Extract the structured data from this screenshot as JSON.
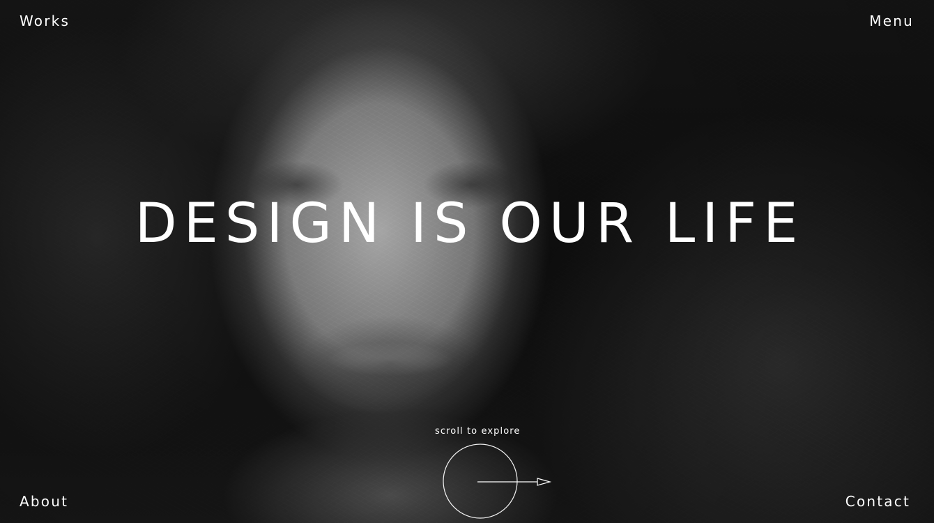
{
  "nav": {
    "works_label": "Works",
    "menu_label": "Menu",
    "about_label": "About",
    "contact_label": "Contact"
  },
  "hero": {
    "headline": "DESIGN IS OUR LIFE"
  },
  "scroll": {
    "label": "scroll to explore",
    "icon": "arrow-right-icon"
  },
  "colors": {
    "text": "#ffffff",
    "background": "#0b0b0b"
  }
}
